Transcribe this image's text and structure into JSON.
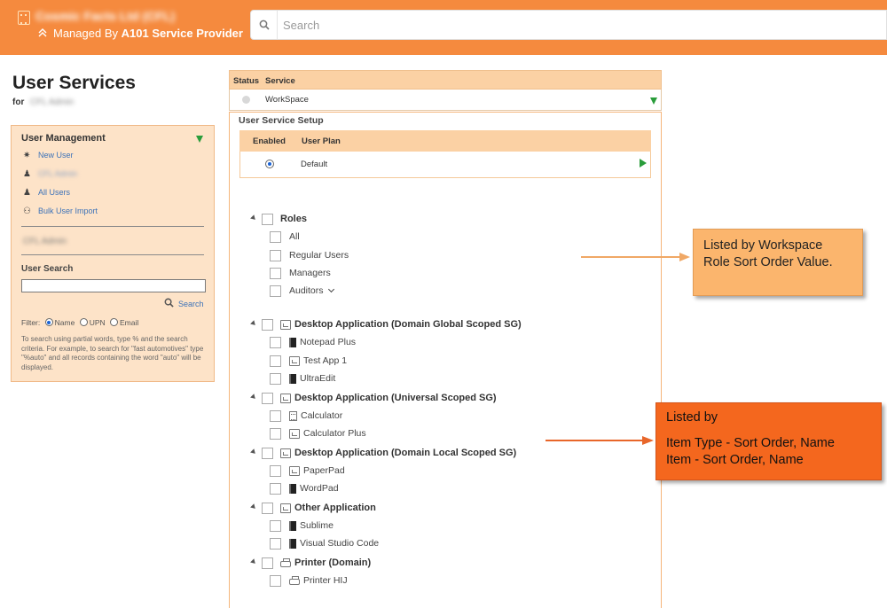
{
  "header": {
    "company_name": "Cosmic Facts Ltd (CFL)",
    "managed_by_prefix": "Managed By",
    "managed_by_provider": "A101 Service Provider",
    "search_placeholder": "Search",
    "icons": [
      "building-icon",
      "chevrons-up-icon",
      "search-icon"
    ]
  },
  "page": {
    "title": "User Services",
    "for_label": "for",
    "for_user": "CFL Admin"
  },
  "left_panel": {
    "heading": "User Management",
    "items": [
      {
        "label": "New User",
        "icon": "new-user-icon"
      },
      {
        "label": "CFL Admin",
        "icon": "user-icon"
      },
      {
        "label": "All Users",
        "icon": "users-icon"
      },
      {
        "label": "Bulk User Import",
        "icon": "hierarchy-icon"
      }
    ],
    "selected_user": "CFL Admin",
    "user_search_heading": "User Search",
    "search_input_value": "",
    "search_link": "Search",
    "filter_label": "Filter:",
    "filter_options": [
      "Name",
      "UPN",
      "Email"
    ],
    "filter_selected": "Name",
    "hint": "To search using partial words, type % and the search criteria. For example, to search for \"fast automotives\" type \"%auto\" and all records containing the word \"auto\" will be displayed."
  },
  "service_table": {
    "col_status": "Status",
    "col_service": "Service",
    "service_value": "WorkSpace"
  },
  "setup": {
    "title": "User Service Setup",
    "col_enabled": "Enabled",
    "col_plan": "User Plan",
    "plan_value": "Default"
  },
  "tree": {
    "roles": {
      "label": "Roles",
      "items": [
        "All",
        "Regular Users",
        "Managers",
        "Auditors"
      ]
    },
    "groups": [
      {
        "label": "Desktop Application (Domain Global Scoped SG)",
        "items": [
          {
            "label": "Notepad Plus",
            "icon": "app-icon"
          },
          {
            "label": "Test App 1",
            "icon": "desktop-icon"
          },
          {
            "label": "UltraEdit",
            "icon": "app-icon"
          }
        ]
      },
      {
        "label": "Desktop Application (Universal Scoped SG)",
        "items": [
          {
            "label": "Calculator",
            "icon": "calculator-icon"
          },
          {
            "label": "Calculator Plus",
            "icon": "desktop-icon"
          }
        ]
      },
      {
        "label": "Desktop Application (Domain Local Scoped SG)",
        "items": [
          {
            "label": "PaperPad",
            "icon": "desktop-icon"
          },
          {
            "label": "WordPad",
            "icon": "app-icon"
          }
        ]
      },
      {
        "label": "Other Application",
        "items": [
          {
            "label": "Sublime",
            "icon": "app-icon"
          },
          {
            "label": "Visual Studio Code",
            "icon": "app-icon"
          }
        ]
      },
      {
        "label": "Printer (Domain)",
        "items": [
          {
            "label": "Printer HIJ",
            "icon": "printer-icon"
          }
        ]
      }
    ]
  },
  "callouts": {
    "one": "Listed by Workspace Role Sort Order Value.",
    "two_line1": "Listed by",
    "two_line2": "Item Type - Sort Order, Name",
    "two_line3": "Item - Sort Order, Name"
  },
  "colors": {
    "header": "#f58a3e",
    "panel": "#fde3c8",
    "table_header": "#fbd1a4",
    "callout_light": "#fbb56d",
    "callout_dark": "#f4671e",
    "accent_green": "#2a9d3b",
    "link_blue": "#3c72b8"
  }
}
